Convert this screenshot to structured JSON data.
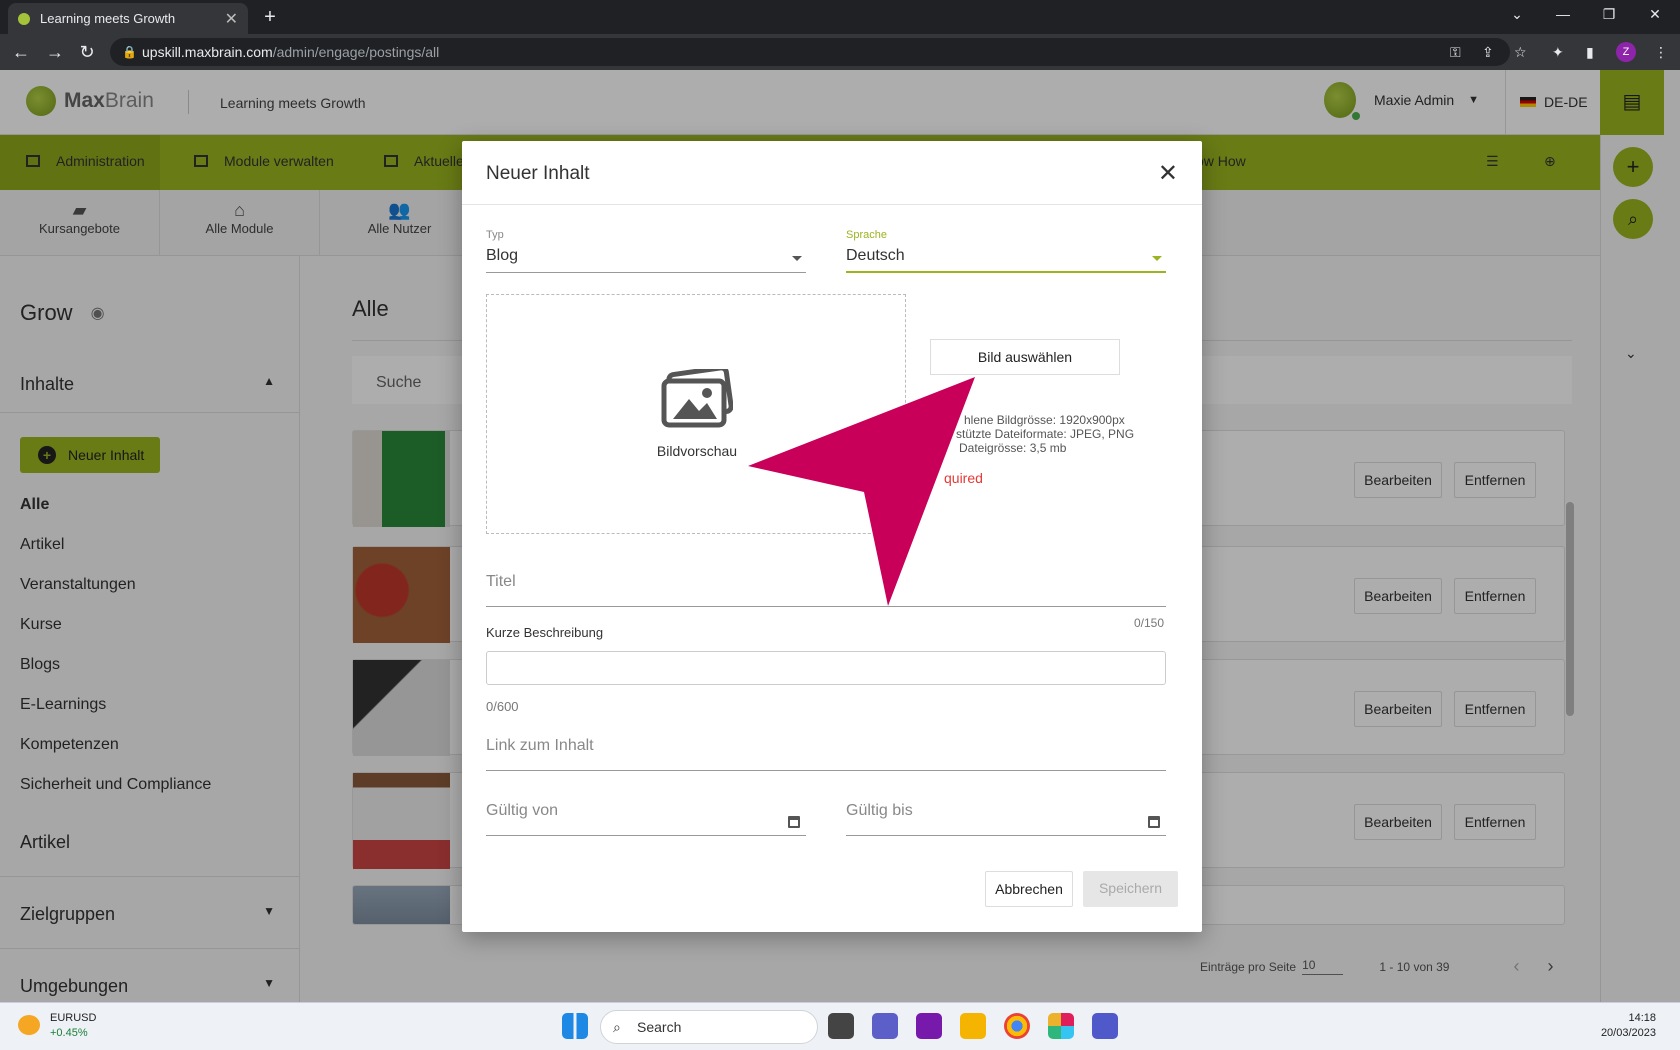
{
  "browser": {
    "tab_title": "Learning meets Growth",
    "url_host": "upskill.maxbrain.com",
    "url_path": "/admin/engage/postings/all",
    "profile_initial": "Z"
  },
  "header": {
    "brand_max": "Max",
    "brand_brain": "Brain",
    "slogan": "Learning meets Growth",
    "user_name": "Maxie Admin",
    "language": "DE-DE"
  },
  "greennav": {
    "items": [
      "Administration",
      "Module verwalten",
      "Aktuelle",
      "ow How"
    ]
  },
  "subnav": {
    "items": [
      "Kursangebote",
      "Alle Module",
      "Alle Nutzer"
    ]
  },
  "sidebar": {
    "title": "Grow",
    "section_inhalte": "Inhalte",
    "new_button": "Neuer Inhalt",
    "items": [
      "Alle",
      "Artikel",
      "Veranstaltungen",
      "Kurse",
      "Blogs",
      "E-Learnings",
      "Kompetenzen",
      "Sicherheit und Compliance"
    ],
    "section_artikel": "Artikel",
    "section_zielgruppen": "Zielgruppen",
    "section_umgebungen": "Umgebungen"
  },
  "main": {
    "title": "Alle",
    "search_placeholder": "Suche",
    "edit_label": "Bearbeiten",
    "remove_label": "Entfernen",
    "per_page_label": "Einträge pro Seite",
    "per_page_value": "10",
    "range": "1 - 10 von 39"
  },
  "modal": {
    "title": "Neuer Inhalt",
    "type_label": "Typ",
    "type_value": "Blog",
    "lang_label": "Sprache",
    "lang_value": "Deutsch",
    "preview_caption": "Bildvorschau",
    "pick_image": "Bild auswählen",
    "hint_size": "hlene Bildgrösse: 1920x900px",
    "hint_formats": "stützte Dateiformate: JPEG, PNG",
    "hint_max": "Dateigrösse: 3,5 mb",
    "required": "quired",
    "title_placeholder": "Titel",
    "title_counter": "0/150",
    "desc_label": "Kurze Beschreibung",
    "desc_counter": "0/600",
    "link_placeholder": "Link zum Inhalt",
    "valid_from": "Gültig von",
    "valid_to": "Gültig bis",
    "cancel": "Abbrechen",
    "save": "Speichern"
  },
  "taskbar": {
    "ticker_symbol": "EURUSD",
    "ticker_change": "+0.45%",
    "search": "Search",
    "time": "14:18",
    "date": "20/03/2023"
  },
  "colors": {
    "brand_green": "#9ab520",
    "arrow": "#c8005a",
    "error": "#e53935"
  }
}
